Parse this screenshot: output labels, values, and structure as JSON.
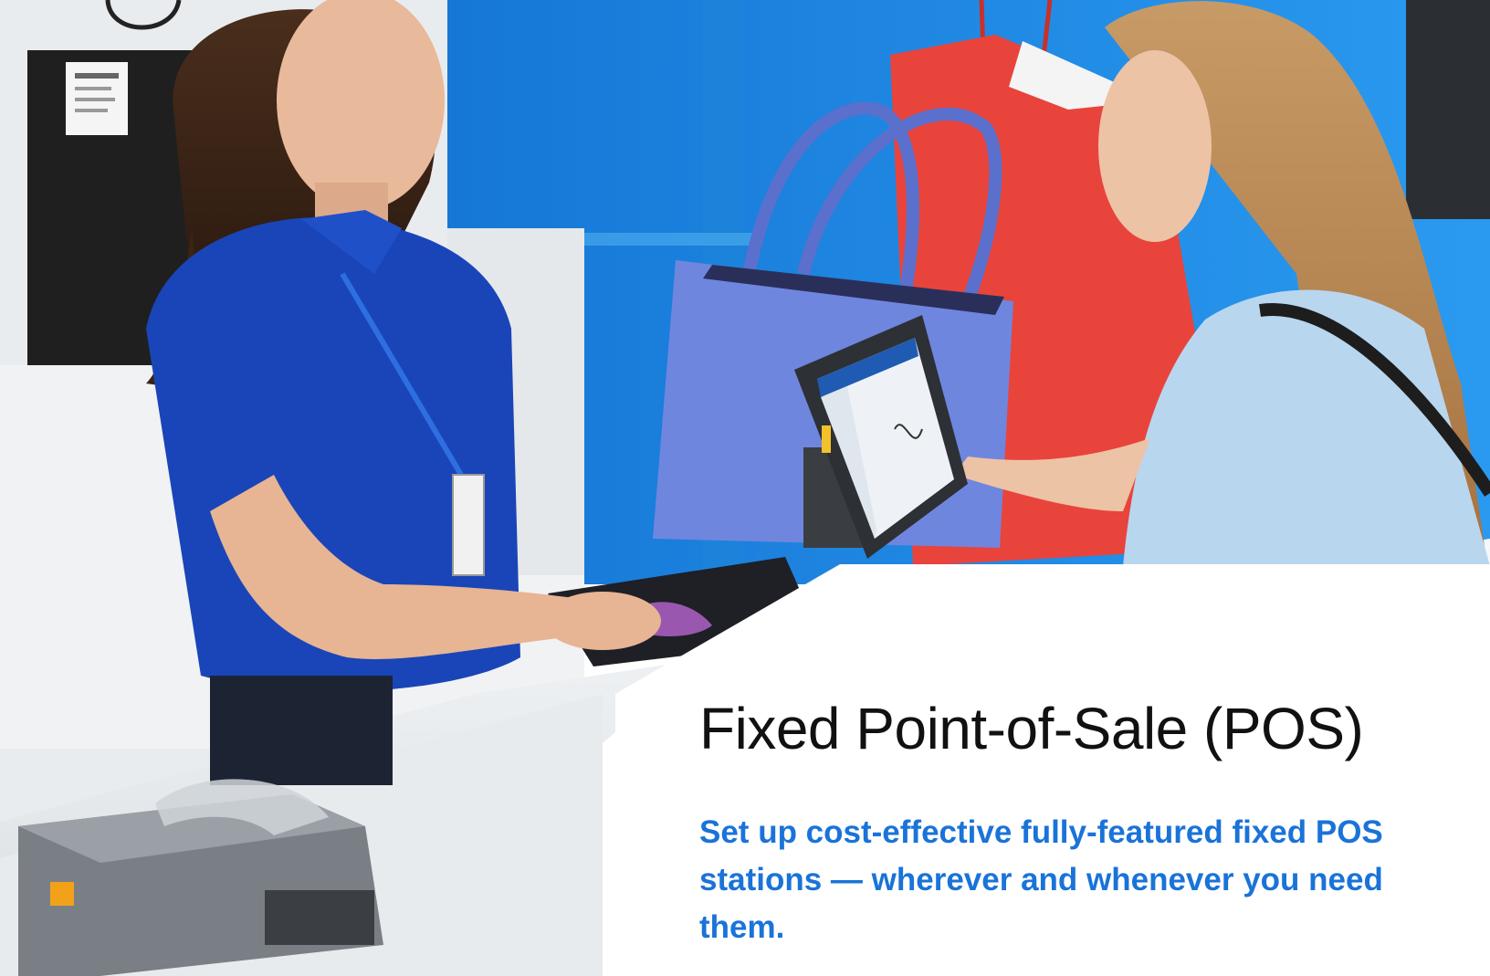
{
  "colors": {
    "panel_background": "#ffffff",
    "title_text": "#111111",
    "subtitle_text": "#1a73d8",
    "wall_blue": "#1b8be3",
    "shirt_blue": "#1a45b8",
    "bag_red": "#e8443c",
    "handbag_periwinkle": "#6f86df",
    "counter_white": "#eef1f3"
  },
  "photo": {
    "icon": "retail-checkout-photo"
  },
  "copy": {
    "title": "Fixed Point-of-Sale (POS)",
    "subtitle": "Set up cost-effective fully-featured fixed POS stations — wherever and whenever you need them."
  }
}
